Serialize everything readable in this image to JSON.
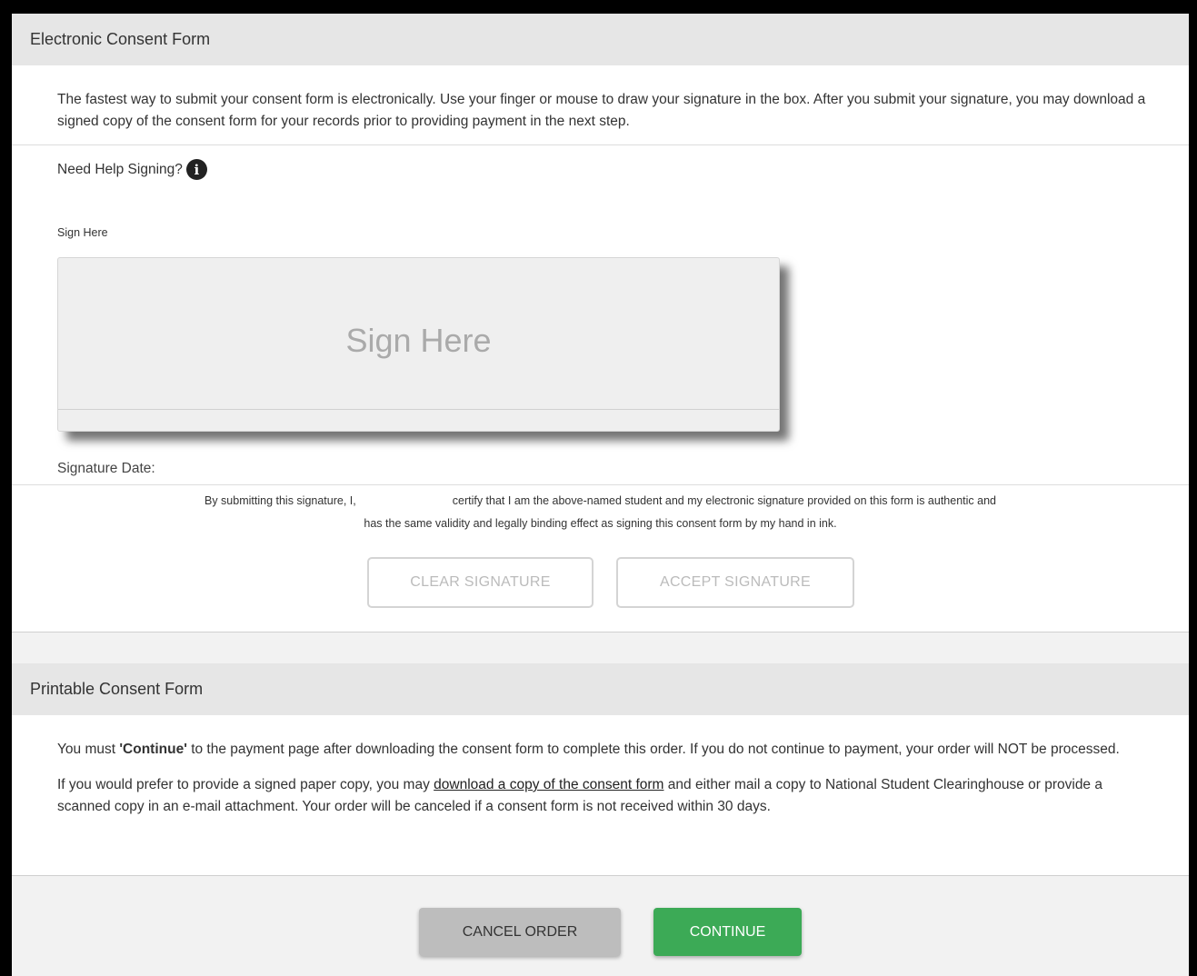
{
  "electronic": {
    "title": "Electronic Consent Form",
    "intro": "The fastest way to submit your consent form is electronically. Use your finger or mouse to draw your signature in the box. After you submit your signature, you may download a signed copy of the consent form for your records prior to providing payment in the next step.",
    "help_label": "Need Help Signing?",
    "help_icon": "info-icon",
    "sign_label": "Sign Here",
    "sign_placeholder": "Sign Here",
    "signature_date_label": "Signature Date:",
    "certify_line1_a": "By submitting this signature, I,",
    "certify_line1_b": "certify that I am the above-named student and my electronic signature provided on this form is authentic and",
    "certify_line2": "has the same validity and legally binding effect as signing this consent form by my hand in ink.",
    "clear_button": "CLEAR SIGNATURE",
    "accept_button": "ACCEPT SIGNATURE"
  },
  "printable": {
    "title": "Printable Consent Form",
    "p1_a": "You must ",
    "p1_bold": "'Continue'",
    "p1_b": " to the payment page after downloading the consent form to complete this order. If you do not continue to payment, your order will NOT be processed.",
    "p2_a": "If you would prefer to provide a signed paper copy, you may ",
    "p2_link": "download a copy of the consent form",
    "p2_b": " and either mail a copy to National Student Clearinghouse or provide a scanned copy in an e-mail attachment. Your order will be canceled if a consent form is not received within 30 days."
  },
  "footer": {
    "cancel_button": "CANCEL ORDER",
    "continue_button": "CONTINUE"
  },
  "colors": {
    "continue": "#3caa56",
    "cancel": "#bdbdbd",
    "header_bg": "#e6e6e6"
  }
}
